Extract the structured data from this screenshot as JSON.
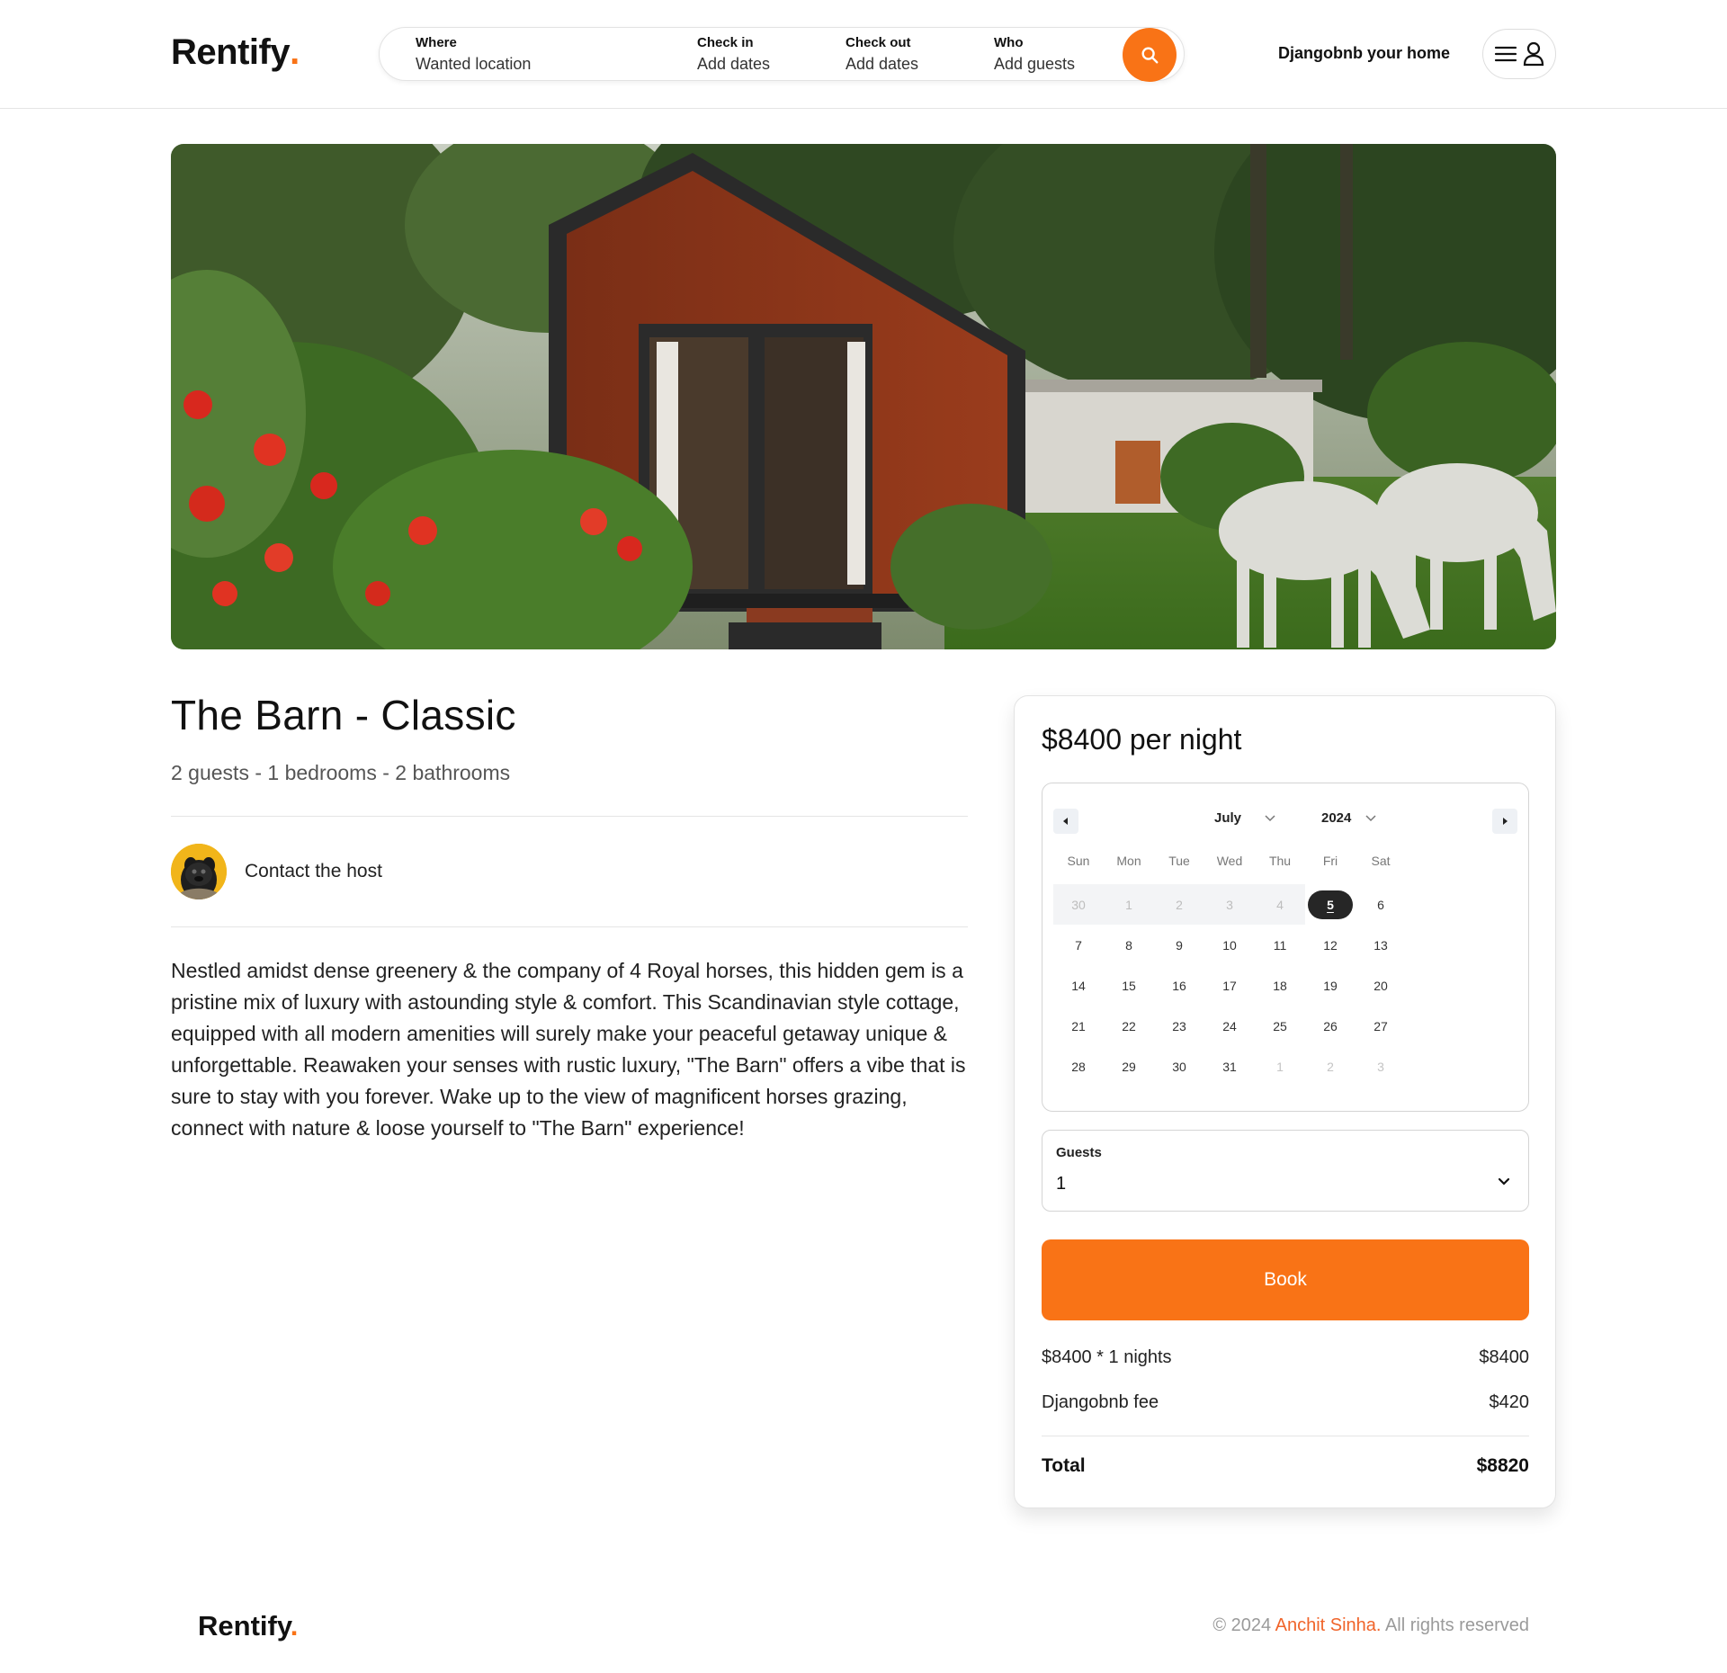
{
  "header": {
    "logo_text": "Rentify",
    "logo_dot": ".",
    "search": {
      "where_label": "Where",
      "where_value": "Wanted location",
      "checkin_label": "Check in",
      "checkin_value": "Add dates",
      "checkout_label": "Check out",
      "checkout_value": "Add dates",
      "who_label": "Who",
      "who_value": "Add guests",
      "button_icon": "search-icon"
    },
    "host_link": "Djangobnb your home",
    "menu_icon": "hamburger-icon",
    "user_icon": "user-icon"
  },
  "listing": {
    "title": "The Barn - Classic",
    "details": "2 guests - 1 bedrooms - 2 bathrooms",
    "contact_label": "Contact the host",
    "description": "Nestled amidst dense greenery & the company of 4 Royal horses, this hidden gem is a pristine mix of luxury with astounding style & comfort. This Scandinavian style cottage, equipped with all modern amenities will surely make your peaceful getaway unique & unforgettable. Reawaken your senses with rustic luxury, \"The Barn\" offers a vibe that is sure to stay with you forever. Wake up to the view of magnificent horses grazing, connect with nature & loose yourself to \"The Barn\" experience!"
  },
  "booking": {
    "price_per_night": "$8400 per night",
    "calendar": {
      "month": "July",
      "year": "2024",
      "weekdays": [
        "Sun",
        "Mon",
        "Tue",
        "Wed",
        "Thu",
        "Fri",
        "Sat"
      ],
      "selected_day": "5",
      "weeks": [
        [
          "30",
          "1",
          "2",
          "3",
          "4",
          "5",
          "6"
        ],
        [
          "7",
          "8",
          "9",
          "10",
          "11",
          "12",
          "13"
        ],
        [
          "14",
          "15",
          "16",
          "17",
          "18",
          "19",
          "20"
        ],
        [
          "21",
          "22",
          "23",
          "24",
          "25",
          "26",
          "27"
        ],
        [
          "28",
          "29",
          "30",
          "31",
          "1",
          "2",
          "3"
        ]
      ]
    },
    "guests_label": "Guests",
    "guests_value": "1",
    "book_label": "Book",
    "nights_line": "$8400 * 1 nights",
    "nights_amount": "$8400",
    "fee_label": "Djangobnb fee",
    "fee_amount": "$420",
    "total_label": "Total",
    "total_amount": "$8820"
  },
  "footer": {
    "logo_text": "Rentify",
    "logo_dot": ".",
    "copyright_prefix": "© 2024",
    "author": "Anchit Sinha.",
    "copyright_suffix": "All rights reserved"
  },
  "colors": {
    "accent": "#f97316",
    "author_link": "#f0642a",
    "selected_day_bg": "#262626"
  }
}
